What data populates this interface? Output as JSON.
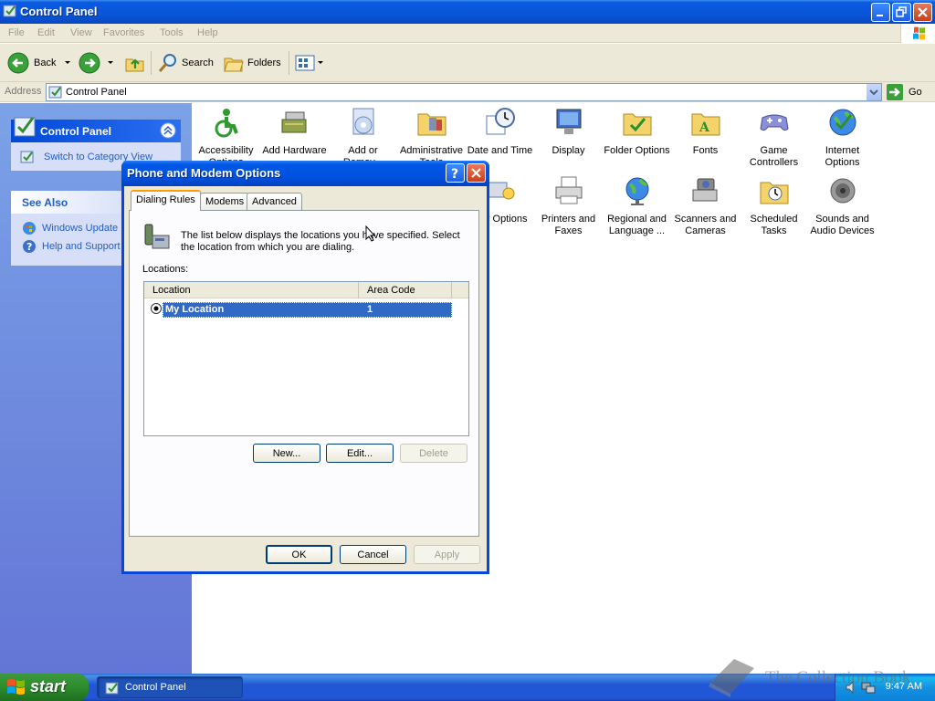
{
  "window": {
    "title": "Control Panel",
    "menu": [
      "File",
      "Edit",
      "View",
      "Favorites",
      "Tools",
      "Help"
    ],
    "toolbar": {
      "back": "Back",
      "search": "Search",
      "folders": "Folders"
    },
    "address": {
      "label": "Address",
      "value": "Control Panel",
      "go": "Go"
    }
  },
  "left_panel": {
    "panel_title": "Control Panel",
    "switch_view": "Switch to Category View",
    "see_also_title": "See Also",
    "see_also_links": [
      "Windows Update",
      "Help and Support"
    ]
  },
  "control_panel_items": [
    {
      "label": "Accessibility Options",
      "icon": "accessibility-icon"
    },
    {
      "label": "Add Hardware",
      "icon": "add-hardware-icon"
    },
    {
      "label": "Add or Remov...",
      "icon": "add-remove-icon"
    },
    {
      "label": "Administrative Tools",
      "icon": "admin-tools-icon"
    },
    {
      "label": "Date and Time",
      "icon": "date-time-icon"
    },
    {
      "label": "Display",
      "icon": "display-icon"
    },
    {
      "label": "Folder Options",
      "icon": "folder-options-icon"
    },
    {
      "label": "Fonts",
      "icon": "fonts-icon"
    },
    {
      "label": "Game Controllers",
      "icon": "game-controllers-icon"
    },
    {
      "label": "Internet Options",
      "icon": "internet-options-icon"
    },
    {
      "label": "...er Options",
      "icon": "power-options-icon"
    },
    {
      "label": "Printers and Faxes",
      "icon": "printers-icon"
    },
    {
      "label": "Regional and Language ...",
      "icon": "regional-icon"
    },
    {
      "label": "Scanners and Cameras",
      "icon": "scanners-icon"
    },
    {
      "label": "Scheduled Tasks",
      "icon": "scheduled-tasks-icon"
    },
    {
      "label": "Sounds and Audio Devices",
      "icon": "sounds-icon"
    }
  ],
  "dialog": {
    "title": "Phone and Modem Options",
    "tabs": [
      "Dialing Rules",
      "Modems",
      "Advanced"
    ],
    "active_tab": "Dialing Rules",
    "description": "The list below displays the locations you have specified. Select the location from which you are dialing.",
    "locations_label": "Locations:",
    "columns": [
      "Location",
      "Area Code"
    ],
    "rows": [
      {
        "location": "My Location",
        "area_code": "1",
        "selected": true
      }
    ],
    "buttons": {
      "new": "New...",
      "edit": "Edit...",
      "delete": "Delete",
      "ok": "OK",
      "cancel": "Cancel",
      "apply": "Apply"
    }
  },
  "taskbar": {
    "start": "start",
    "task": "Control Panel",
    "clock": "9:47 AM"
  },
  "watermark": "The Collection Book",
  "colors": {
    "xp_blue": "#0a5ae0",
    "selection": "#316ac5",
    "start_green": "#2e8b2e"
  }
}
